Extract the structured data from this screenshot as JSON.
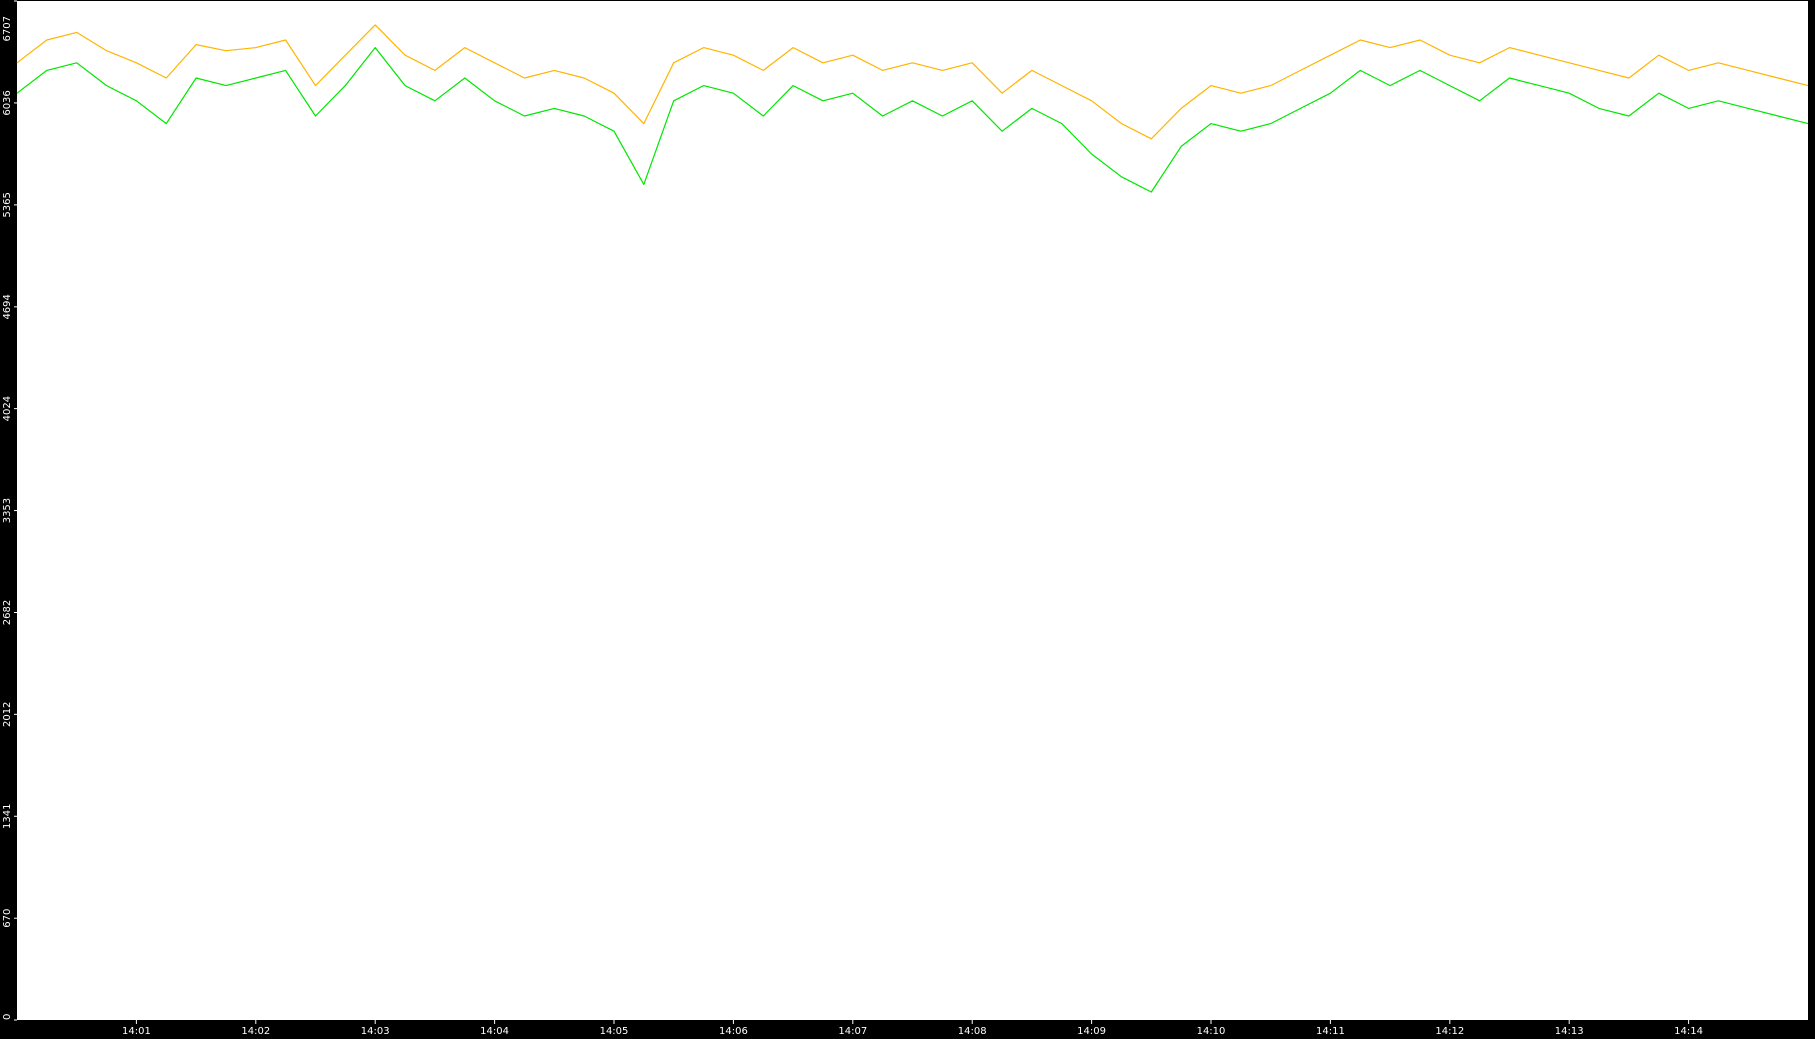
{
  "chart_data": {
    "type": "line",
    "title": "",
    "xlabel": "",
    "ylabel": "",
    "background": "#ffffff",
    "frame_color": "#000000",
    "grid": false,
    "legend": "none",
    "x_start": "14:00:00",
    "x_end": "14:15:00",
    "x_ticks": [
      "14:01",
      "14:02",
      "14:03",
      "14:04",
      "14:05",
      "14:06",
      "14:07",
      "14:08",
      "14:09",
      "14:10",
      "14:11",
      "14:12",
      "14:13",
      "14:14"
    ],
    "y_ticks": [
      0,
      670,
      1341,
      2012,
      2682,
      3353,
      4024,
      4694,
      5365,
      6036,
      6707
    ],
    "ylim": [
      0,
      6707
    ],
    "series": [
      {
        "color": "#ffb400",
        "x": [
          "14:00:00",
          "14:00:15",
          "14:00:30",
          "14:00:45",
          "14:01:00",
          "14:01:15",
          "14:01:30",
          "14:01:45",
          "14:02:00",
          "14:02:15",
          "14:02:30",
          "14:02:45",
          "14:03:00",
          "14:03:15",
          "14:03:30",
          "14:03:45",
          "14:04:00",
          "14:04:15",
          "14:04:30",
          "14:04:45",
          "14:05:00",
          "14:05:15",
          "14:05:30",
          "14:05:45",
          "14:06:00",
          "14:06:15",
          "14:06:30",
          "14:06:45",
          "14:07:00",
          "14:07:15",
          "14:07:30",
          "14:07:45",
          "14:08:00",
          "14:08:15",
          "14:08:30",
          "14:08:45",
          "14:09:00",
          "14:09:15",
          "14:09:30",
          "14:09:45",
          "14:10:00",
          "14:10:15",
          "14:10:30",
          "14:10:45",
          "14:11:00",
          "14:11:15",
          "14:11:30",
          "14:11:45",
          "14:12:00",
          "14:12:15",
          "14:12:30",
          "14:12:45",
          "14:13:00",
          "14:13:15",
          "14:13:30",
          "14:13:45",
          "14:14:00",
          "14:14:15",
          "14:14:30",
          "14:14:45",
          "14:15:00"
        ],
        "values": [
          6300,
          6450,
          6500,
          6380,
          6300,
          6200,
          6420,
          6380,
          6400,
          6450,
          6150,
          6350,
          6550,
          6350,
          6250,
          6400,
          6300,
          6200,
          6250,
          6200,
          6100,
          5900,
          6300,
          6400,
          6350,
          6250,
          6400,
          6300,
          6350,
          6250,
          6300,
          6250,
          6300,
          6100,
          6250,
          6150,
          6050,
          5900,
          5800,
          6000,
          6150,
          6100,
          6150,
          6250,
          6350,
          6450,
          6400,
          6450,
          6350,
          6300,
          6400,
          6350,
          6300,
          6250,
          6200,
          6350,
          6250,
          6300,
          6250,
          6200,
          6150
        ]
      },
      {
        "color": "#00e600",
        "x": [
          "14:00:00",
          "14:00:15",
          "14:00:30",
          "14:00:45",
          "14:01:00",
          "14:01:15",
          "14:01:30",
          "14:01:45",
          "14:02:00",
          "14:02:15",
          "14:02:30",
          "14:02:45",
          "14:03:00",
          "14:03:15",
          "14:03:30",
          "14:03:45",
          "14:04:00",
          "14:04:15",
          "14:04:30",
          "14:04:45",
          "14:05:00",
          "14:05:15",
          "14:05:30",
          "14:05:45",
          "14:06:00",
          "14:06:15",
          "14:06:30",
          "14:06:45",
          "14:07:00",
          "14:07:15",
          "14:07:30",
          "14:07:45",
          "14:08:00",
          "14:08:15",
          "14:08:30",
          "14:08:45",
          "14:09:00",
          "14:09:15",
          "14:09:30",
          "14:09:45",
          "14:10:00",
          "14:10:15",
          "14:10:30",
          "14:10:45",
          "14:11:00",
          "14:11:15",
          "14:11:30",
          "14:11:45",
          "14:12:00",
          "14:12:15",
          "14:12:30",
          "14:12:45",
          "14:13:00",
          "14:13:15",
          "14:13:30",
          "14:13:45",
          "14:14:00",
          "14:14:15",
          "14:14:30",
          "14:14:45",
          "14:15:00"
        ],
        "values": [
          6100,
          6250,
          6300,
          6150,
          6050,
          5900,
          6200,
          6150,
          6200,
          6250,
          5950,
          6150,
          6400,
          6150,
          6050,
          6200,
          6050,
          5950,
          6000,
          5950,
          5850,
          5500,
          6050,
          6150,
          6100,
          5950,
          6150,
          6050,
          6100,
          5950,
          6050,
          5950,
          6050,
          5850,
          6000,
          5900,
          5700,
          5550,
          5450,
          5750,
          5900,
          5850,
          5900,
          6000,
          6100,
          6250,
          6150,
          6250,
          6150,
          6050,
          6200,
          6150,
          6100,
          6000,
          5950,
          6100,
          6000,
          6050,
          6000,
          5950,
          5900
        ]
      }
    ]
  }
}
